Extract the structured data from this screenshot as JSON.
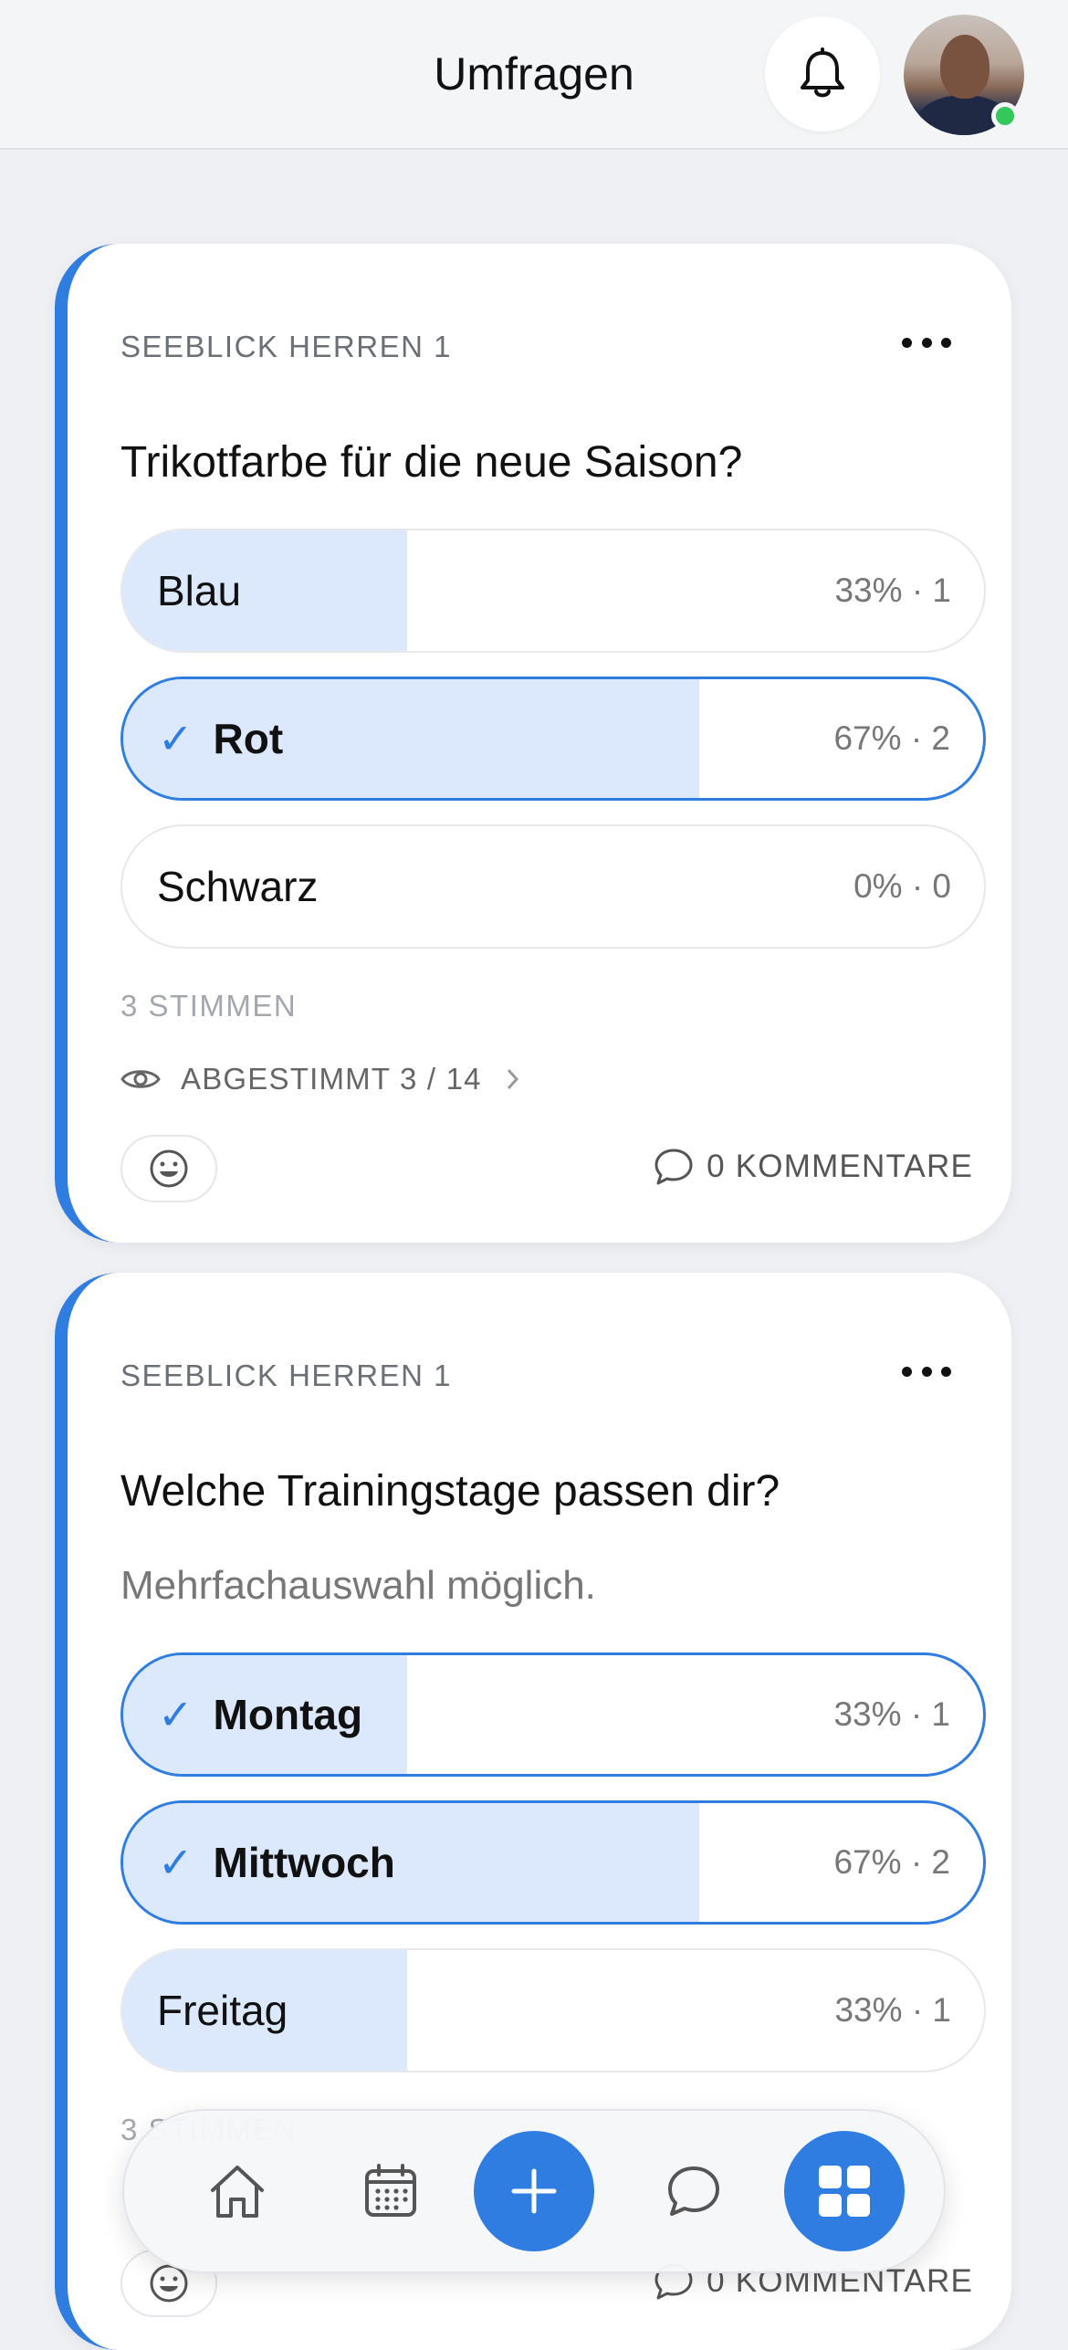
{
  "header": {
    "title": "Umfragen",
    "bell_icon": "bell-icon",
    "avatar_alt": "user-avatar",
    "online_color": "#34c759"
  },
  "accent_color": "#2f7de1",
  "polls": [
    {
      "team": "SEEBLICK HERREN 1",
      "question": "Trikotfarbe für die neue Saison?",
      "options": [
        {
          "label": "Blau",
          "result": "33% · 1",
          "percent": 33,
          "selected": false
        },
        {
          "label": "Rot",
          "result": "67% · 2",
          "percent": 67,
          "selected": true
        },
        {
          "label": "Schwarz",
          "result": "0% · 0",
          "percent": 0,
          "selected": false
        }
      ],
      "votes": "3 STIMMEN",
      "voted": "ABGESTIMMT 3 / 14",
      "comments": "0 KOMMENTARE"
    },
    {
      "team": "SEEBLICK HERREN 1",
      "question": "Welche Trainingstage passen dir?",
      "subtitle": "Mehrfachauswahl möglich.",
      "options": [
        {
          "label": "Montag",
          "result": "33% · 1",
          "percent": 33,
          "selected": true
        },
        {
          "label": "Mittwoch",
          "result": "67% · 2",
          "percent": 67,
          "selected": true
        },
        {
          "label": "Freitag",
          "result": "33% · 1",
          "percent": 33,
          "selected": false
        }
      ],
      "votes": "3 STIMMEN",
      "comments": "0 KOMMENTARE"
    }
  ],
  "check_glyph": "✓",
  "bottom_nav": {
    "items": [
      "home-icon",
      "calendar-icon",
      "plus-icon",
      "chat-icon",
      "grid-icon"
    ]
  }
}
